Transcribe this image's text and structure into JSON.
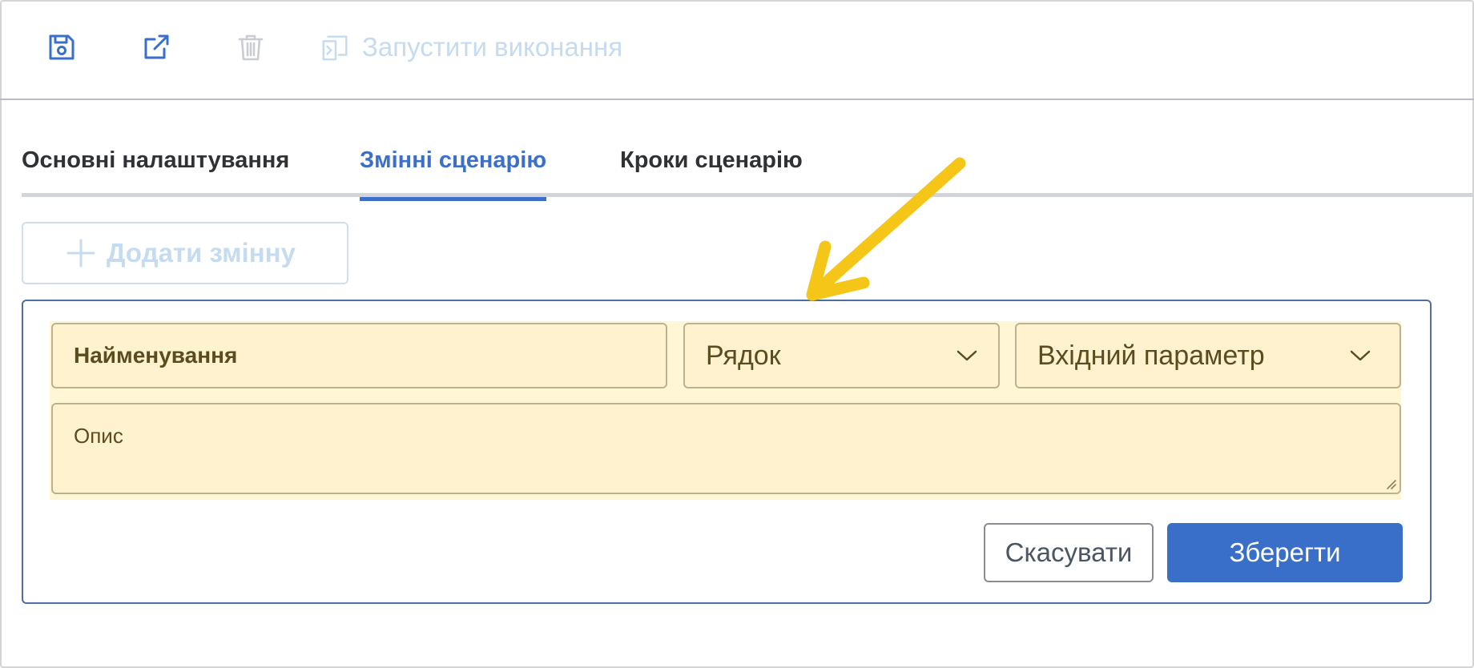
{
  "toolbar": {
    "icons": [
      "save-icon",
      "external-link-icon",
      "trash-icon",
      "run-icon"
    ],
    "run_label": "Запустити виконання"
  },
  "tabs": [
    {
      "label": "Основні налаштування",
      "active": false
    },
    {
      "label": "Змінні сценарію",
      "active": true
    },
    {
      "label": "Кроки сценарію",
      "active": false
    }
  ],
  "add_variable": {
    "label": "Додати змінну",
    "icon": "plus-icon",
    "disabled": true
  },
  "variable_form": {
    "name_placeholder": "Найменування",
    "type_value": "Рядок",
    "direction_value": "Вхідний параметр",
    "description_placeholder": "Опис",
    "cancel_label": "Скасувати",
    "save_label": "Зберегти"
  },
  "colors": {
    "accent": "#3b6fc9",
    "disabled": "#c5dbf0",
    "field_bg": "#fff2cf",
    "highlight_bg": "#fff6d5",
    "annotation_arrow": "#f5c518"
  }
}
